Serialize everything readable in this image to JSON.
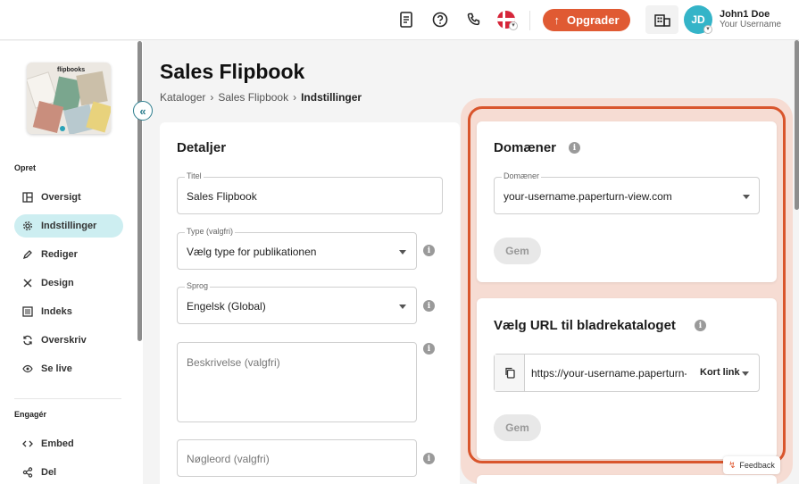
{
  "topbar": {
    "upgrade_label": "Opgrader",
    "user_initials": "JD",
    "user_name": "John1 Doe",
    "user_subtitle": "Your Username"
  },
  "sidebar": {
    "thumb_label": "flipbooks",
    "sections": [
      {
        "title": "Opret",
        "items": [
          {
            "label": "Oversigt",
            "icon": "overview-icon"
          },
          {
            "label": "Indstillinger",
            "icon": "gear-icon",
            "active": true
          },
          {
            "label": "Rediger",
            "icon": "pencil-icon"
          },
          {
            "label": "Design",
            "icon": "design-tools-icon"
          },
          {
            "label": "Indeks",
            "icon": "index-list-icon"
          },
          {
            "label": "Overskriv",
            "icon": "refresh-icon"
          },
          {
            "label": "Se live",
            "icon": "eye-icon"
          }
        ]
      },
      {
        "title": "Engagér",
        "items": [
          {
            "label": "Embed",
            "icon": "code-icon"
          },
          {
            "label": "Del",
            "icon": "share-icon"
          }
        ]
      }
    ]
  },
  "page": {
    "title": "Sales Flipbook",
    "breadcrumb": [
      "Kataloger",
      "Sales Flipbook",
      "Indstillinger"
    ]
  },
  "details": {
    "heading": "Detaljer",
    "title_label": "Titel",
    "title_value": "Sales Flipbook",
    "type_label": "Type (valgfri)",
    "type_value": "Vælg type for publikationen",
    "language_label": "Sprog",
    "language_value": "Engelsk (Global)",
    "description_placeholder": "Beskrivelse (valgfri)",
    "keywords_placeholder": "Nøgleord (valgfri)"
  },
  "domains": {
    "heading": "Domæner",
    "field_label": "Domæner",
    "field_value": "your-username.paperturn-view.com",
    "save_label": "Gem"
  },
  "url": {
    "heading": "Vælg URL til bladrekataloget",
    "value": "https://your-username.paperturn-view.com",
    "link_type": "Kort link",
    "save_label": "Gem"
  },
  "feedback_label": "Feedback",
  "colors": {
    "accent": "#e05a33",
    "teal": "#34b4c8",
    "active_nav": "#cdeef1",
    "highlight_outline": "#d9552c"
  }
}
